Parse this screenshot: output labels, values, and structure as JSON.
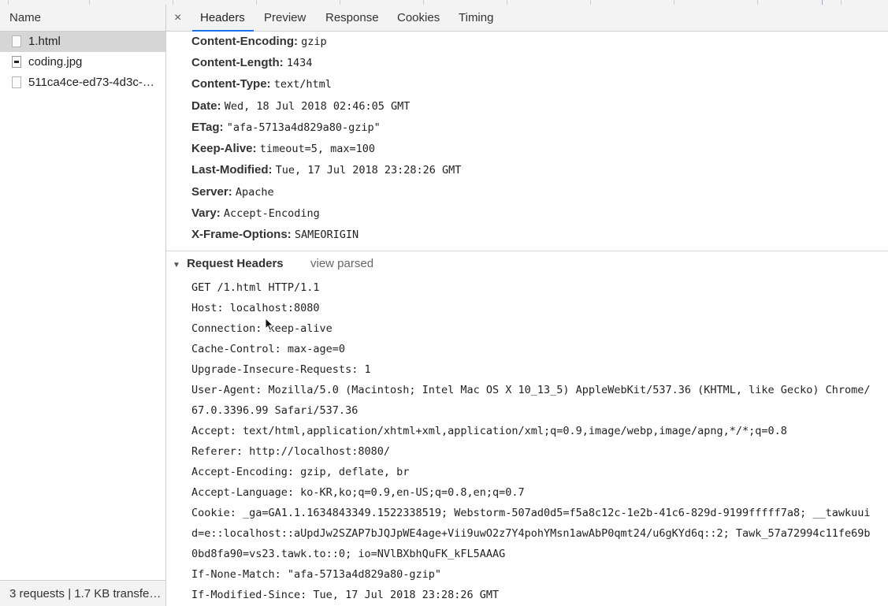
{
  "network_list": {
    "header": "Name",
    "requests": [
      {
        "name": "1.html",
        "icon": "document-icon",
        "selected": true
      },
      {
        "name": "coding.jpg",
        "icon": "image-file-icon",
        "selected": false
      },
      {
        "name": "511ca4ce-ed73-4d3c-…",
        "icon": "document-icon",
        "selected": false
      }
    ],
    "footer": "3 requests | 1.7 KB transfe…"
  },
  "tabs": {
    "close_icon": "×",
    "items": [
      "Headers",
      "Preview",
      "Response",
      "Cookies",
      "Timing"
    ],
    "active": "Headers"
  },
  "response_headers": [
    {
      "key": "Content-Encoding:",
      "value": "gzip"
    },
    {
      "key": "Content-Length:",
      "value": "1434"
    },
    {
      "key": "Content-Type:",
      "value": "text/html"
    },
    {
      "key": "Date:",
      "value": "Wed, 18 Jul 2018 02:46:05 GMT"
    },
    {
      "key": "ETag:",
      "value": "\"afa-5713a4d829a80-gzip\""
    },
    {
      "key": "Keep-Alive:",
      "value": "timeout=5, max=100"
    },
    {
      "key": "Last-Modified:",
      "value": "Tue, 17 Jul 2018 23:28:26 GMT"
    },
    {
      "key": "Server:",
      "value": "Apache"
    },
    {
      "key": "Vary:",
      "value": "Accept-Encoding"
    },
    {
      "key": "X-Frame-Options:",
      "value": "SAMEORIGIN"
    }
  ],
  "request_headers": {
    "toggle": "▼",
    "title": "Request Headers",
    "view_parsed": "view parsed",
    "lines": [
      "GET /1.html HTTP/1.1",
      "Host: localhost:8080",
      "Connection: keep-alive",
      "Cache-Control: max-age=0",
      "Upgrade-Insecure-Requests: 1",
      "User-Agent: Mozilla/5.0 (Macintosh; Intel Mac OS X 10_13_5) AppleWebKit/537.36 (KHTML, like Gecko) Chrome/",
      "67.0.3396.99 Safari/537.36",
      "Accept: text/html,application/xhtml+xml,application/xml;q=0.9,image/webp,image/apng,*/*;q=0.8",
      "Referer: http://localhost:8080/",
      "Accept-Encoding: gzip, deflate, br",
      "Accept-Language: ko-KR,ko;q=0.9,en-US;q=0.8,en;q=0.7",
      "Cookie: _ga=GA1.1.1634843349.1522338519; Webstorm-507ad0d5=f5a8c12c-1e2b-41c6-829d-9199fffff7a8; __tawkuui",
      "d=e::localhost::aUpdJw2SZAP7bJQJpWE4age+Vii9uwO2z7Y4pohYMsn1awAbP0qmt24/u6gKYd6q::2; Tawk_57a72994c11fe69b",
      "0bd8fa90=vs23.tawk.to::0; io=NVlBXbhQuFK_kFL5AAAG",
      "If-None-Match: \"afa-5713a4d829a80-gzip\"",
      "If-Modified-Since: Tue, 17 Jul 2018 23:28:26 GMT"
    ]
  }
}
